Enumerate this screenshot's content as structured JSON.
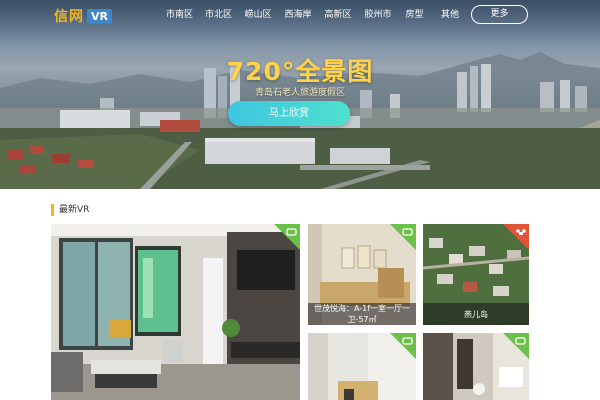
{
  "header": {
    "logo_text": "信网",
    "logo_badge": "VR",
    "nav_items": [
      {
        "label": "市南区"
      },
      {
        "label": "市北区"
      },
      {
        "label": "崂山区"
      },
      {
        "label": "西海岸"
      },
      {
        "label": "高新区"
      },
      {
        "label": "胶州市"
      },
      {
        "label": "房型"
      },
      {
        "label": "其他"
      }
    ],
    "more_label": "更多"
  },
  "hero": {
    "title": "720°全景图",
    "subtitle": "青岛石老人旅游度假区",
    "button_label": "马上欣赏"
  },
  "section": {
    "title": "最新VR"
  },
  "cards": [
    {
      "caption": "",
      "tag_icon": "vr-headset-icon"
    },
    {
      "caption": "世茂悦海：A-1f一室一厅一卫-57㎡",
      "tag_icon": "vr-headset-icon"
    },
    {
      "caption": "燕儿岛",
      "tag_icon": "drone-icon"
    },
    {
      "caption": "",
      "tag_icon": "vr-headset-icon"
    },
    {
      "caption": "",
      "tag_icon": "vr-headset-icon"
    }
  ],
  "colors": {
    "brand_yellow": "#f2b51f",
    "badge_blue": "#3f86c9",
    "tag_green": "#6cc04a",
    "tag_red": "#e2543a",
    "button_cyan": "#3fc6e0"
  }
}
